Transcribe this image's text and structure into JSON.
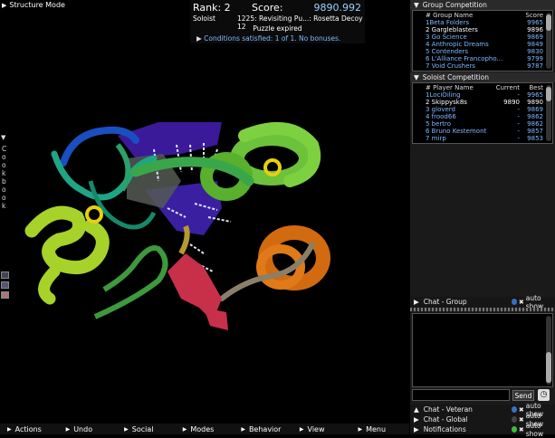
{
  "viewport": {
    "mode_label": "Structure Mode"
  },
  "score_panel": {
    "rank": "Rank: 2",
    "score_label": "Score:",
    "score_value": "9890.992",
    "player": "Soloist",
    "puzzle": "1225: Revisiting Pu...: Rosetta Decoy 12",
    "status": "Puzzle expired",
    "conditions": "Conditions satisfied: 1 of 1. No bonuses."
  },
  "cookbook": {
    "label": "Cookbook"
  },
  "group_competition": {
    "title": "Group Competition",
    "headers": {
      "name": "# Group Name",
      "score": "Score"
    },
    "rows": [
      {
        "name": "1Beta Folders",
        "score": "9965",
        "self": false
      },
      {
        "name": "2 Gargleblasters",
        "score": "9896",
        "self": true
      },
      {
        "name": "3 Go Science",
        "score": "9869",
        "self": false
      },
      {
        "name": "4 Anthropic Dreams",
        "score": "9849",
        "self": false
      },
      {
        "name": "5 Contenders",
        "score": "9830",
        "self": false
      },
      {
        "name": "6 L'Alliance Francopho...",
        "score": "9799",
        "self": false
      },
      {
        "name": "7 Void Crushers",
        "score": "9787",
        "self": false
      }
    ]
  },
  "soloist_competition": {
    "title": "Soloist Competition",
    "headers": {
      "name": "# Player Name",
      "current": "Current",
      "best": "Best"
    },
    "rows": [
      {
        "name": "1LociOiling",
        "current": "-",
        "best": "9965",
        "self": false
      },
      {
        "name": "2 Skippysk8s",
        "current": "9890",
        "best": "9890",
        "self": true
      },
      {
        "name": "3 gloverd",
        "current": "-",
        "best": "9869",
        "self": false
      },
      {
        "name": "4 frood66",
        "current": "-",
        "best": "9862",
        "self": false
      },
      {
        "name": "5 bertro",
        "current": "-",
        "best": "9862",
        "self": false
      },
      {
        "name": "6 Bruno Kestemont",
        "current": "-",
        "best": "9857",
        "self": false
      },
      {
        "name": "7 mirp",
        "current": "-",
        "best": "9853",
        "self": false
      }
    ]
  },
  "chat_group": {
    "title": "Chat - Group",
    "auto_show": "auto show",
    "send": "Send"
  },
  "chats": [
    {
      "title": "Chat - Veteran",
      "auto_show": "auto show",
      "color": "#3a6fc4"
    },
    {
      "title": "Chat - Global",
      "auto_show": "auto show",
      "color": "#444444"
    },
    {
      "title": "Notifications",
      "auto_show": "auto show",
      "color": "#3bbf3b"
    }
  ],
  "toolbar": [
    {
      "label": "Actions",
      "name": "actions-menu"
    },
    {
      "label": "Undo",
      "name": "undo-menu"
    },
    {
      "label": "Social",
      "name": "social-menu"
    },
    {
      "label": "Modes",
      "name": "modes-menu"
    },
    {
      "label": "Behavior",
      "name": "behavior-menu"
    },
    {
      "label": "View",
      "name": "view-menu"
    },
    {
      "label": "Menu",
      "name": "main-menu"
    }
  ]
}
